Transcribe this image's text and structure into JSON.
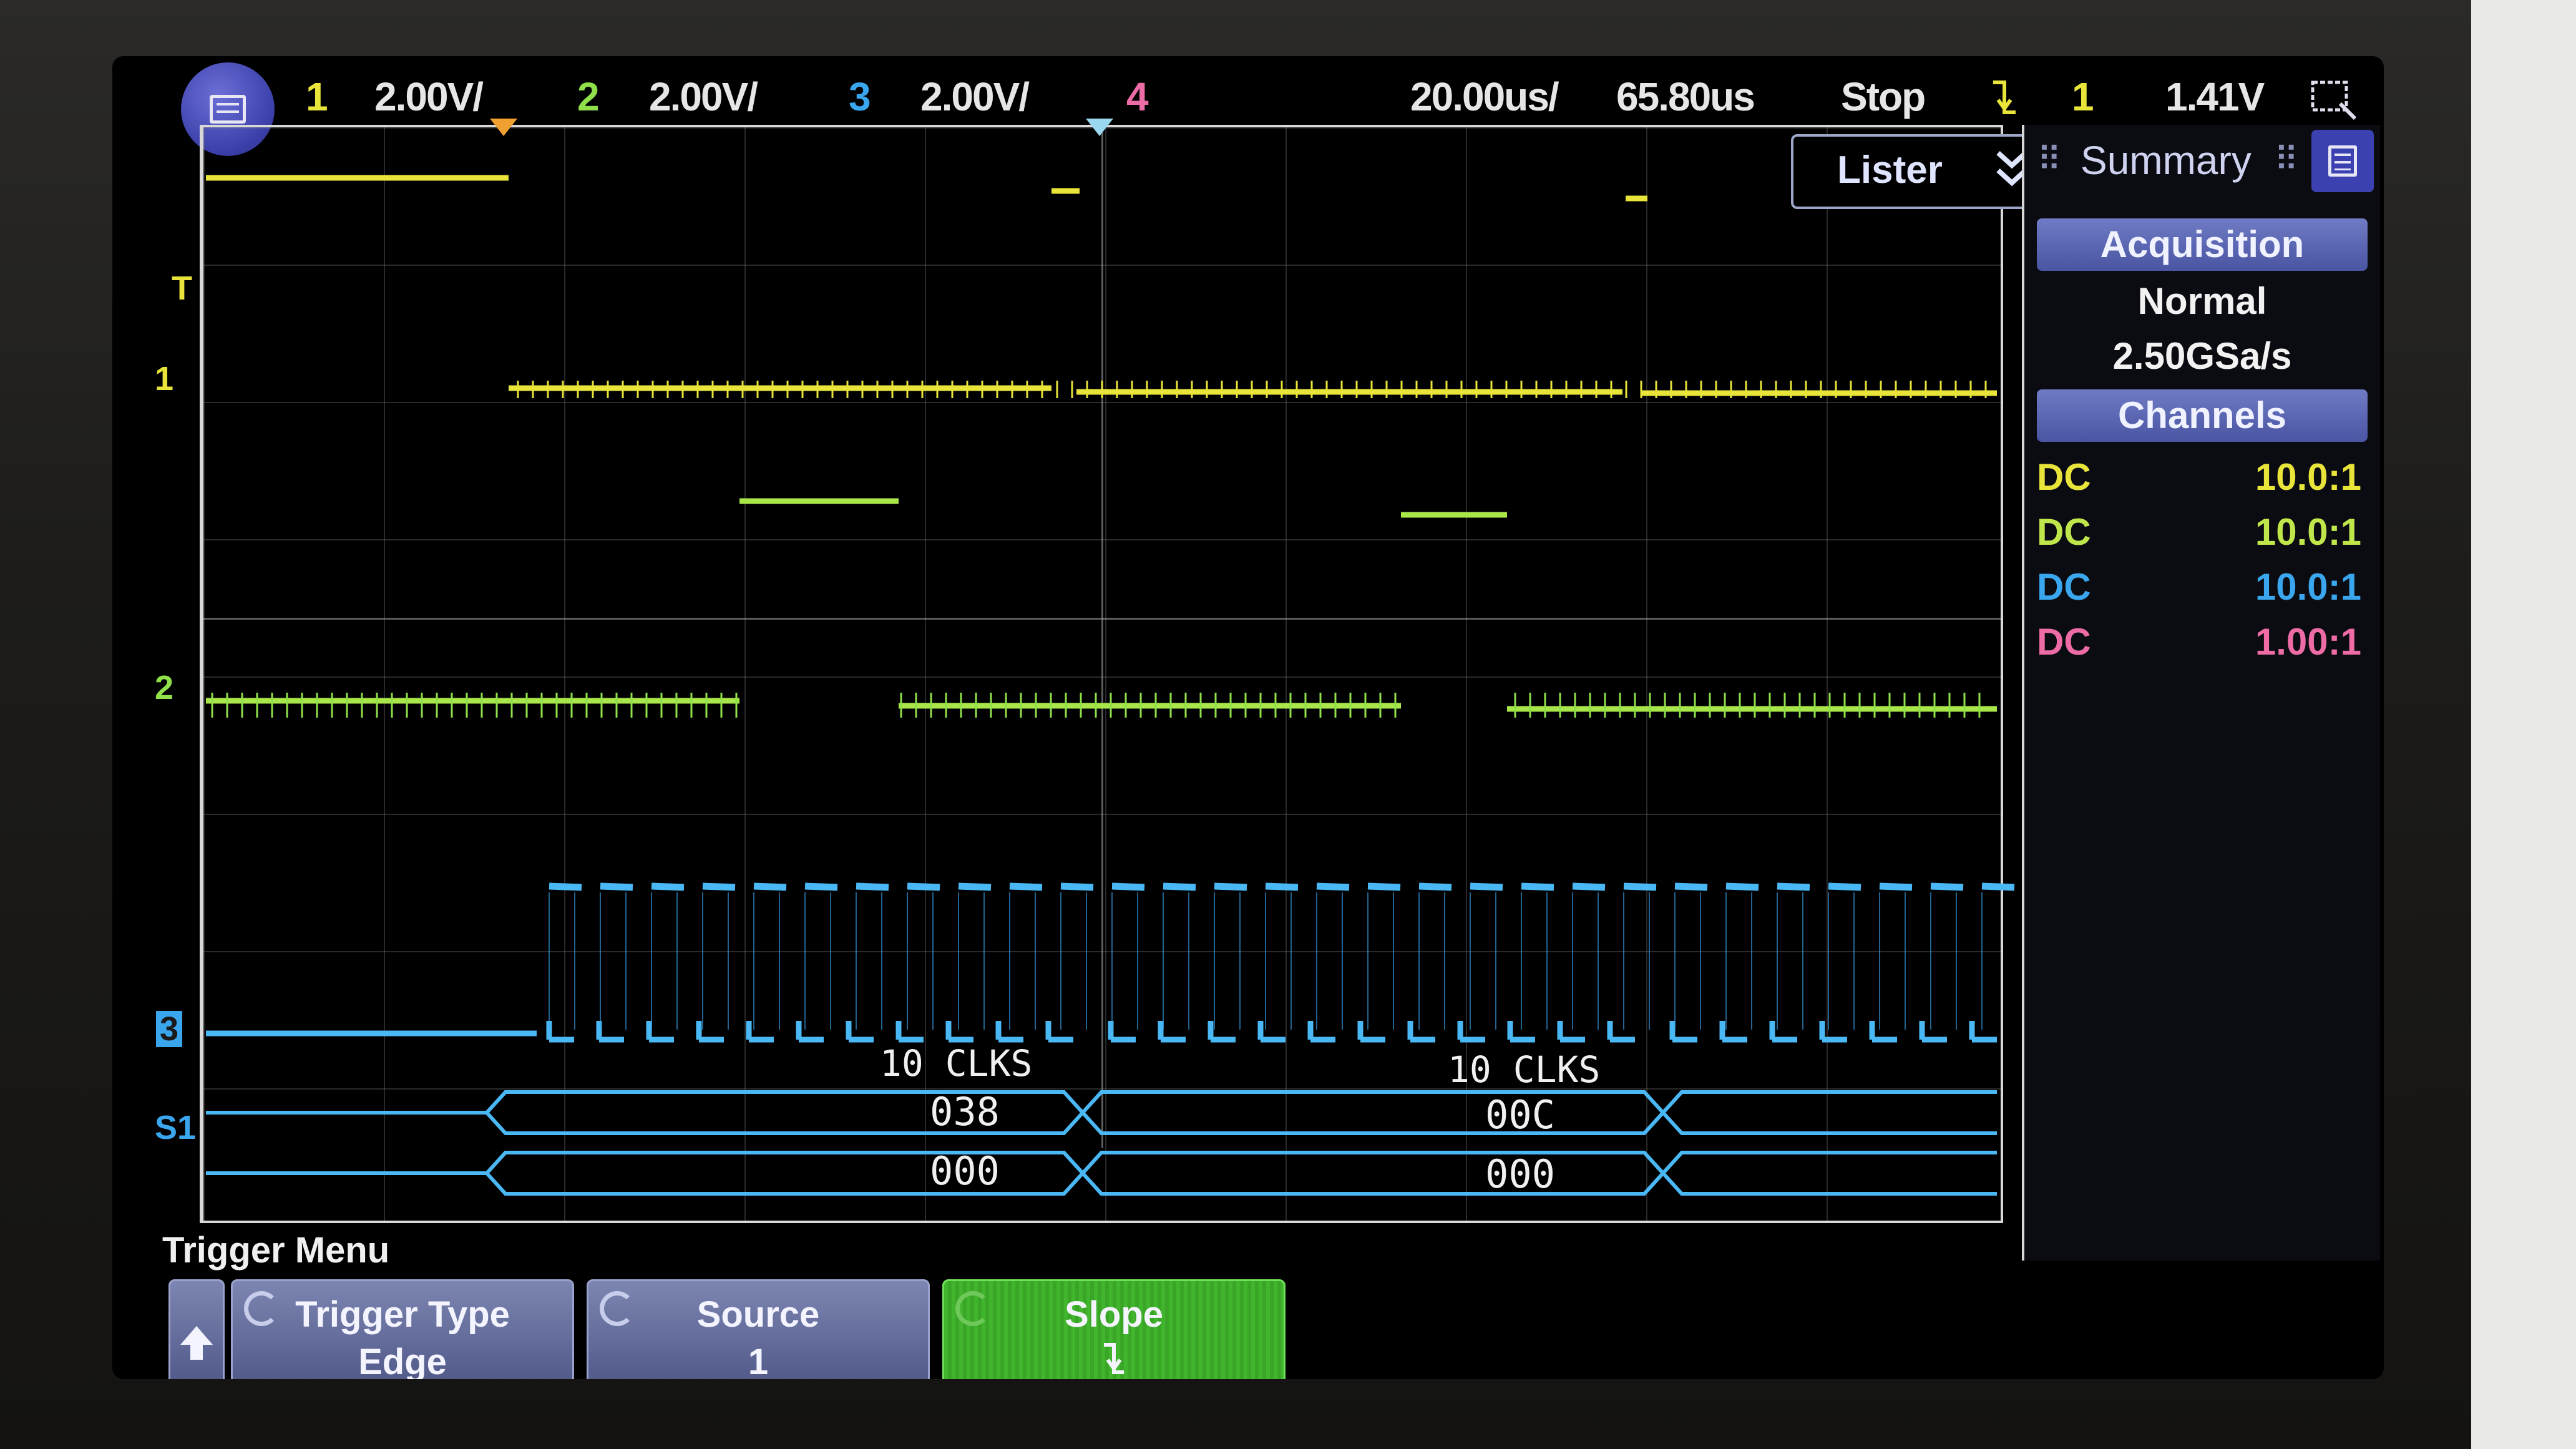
{
  "topbar": {
    "ch1_num": "1",
    "ch1_scale": "2.00V/",
    "ch2_num": "2",
    "ch2_scale": "2.00V/",
    "ch3_num": "3",
    "ch3_scale": "2.00V/",
    "ch4_num": "4",
    "timebase": "20.00us/",
    "delay": "65.80us",
    "run_state": "Stop",
    "trigger_source": "1",
    "trigger_level": "1.41V"
  },
  "markers": {
    "ch1": "1",
    "ch2": "2",
    "ch3": "3",
    "bus": "S1",
    "trigger": "T"
  },
  "lister": {
    "label": "Lister"
  },
  "panel": {
    "title": "Summary",
    "acquisition_header": "Acquisition",
    "acquisition_mode": "Normal",
    "sample_rate": "2.50GSa/s",
    "channels_header": "Channels",
    "channels": [
      {
        "coupling": "DC",
        "probe": "10.0:1",
        "color": "#e8e43a"
      },
      {
        "coupling": "DC",
        "probe": "10.0:1",
        "color": "#8fe04a"
      },
      {
        "coupling": "DC",
        "probe": "10.0:1",
        "color": "#3aa6ee"
      },
      {
        "coupling": "DC",
        "probe": "1.00:1",
        "color": "#ee6ca6"
      }
    ]
  },
  "decode": {
    "annotation_1": "10  CLKS",
    "annotation_2": "10  CLKS",
    "row1": [
      "038",
      "00C"
    ],
    "row2": [
      "000",
      "000"
    ]
  },
  "softkeys": {
    "menu_title": "Trigger Menu",
    "trigger_type_label": "Trigger Type",
    "trigger_type_value": "Edge",
    "source_label": "Source",
    "source_value": "1",
    "slope_label": "Slope"
  },
  "colors": {
    "ch1": "#e8e43a",
    "ch2": "#8fe04a",
    "ch3": "#3aa6ee",
    "ch4": "#ee6ca6",
    "active_softkey": "#41b52d",
    "panel_header": "#5a65b4"
  }
}
